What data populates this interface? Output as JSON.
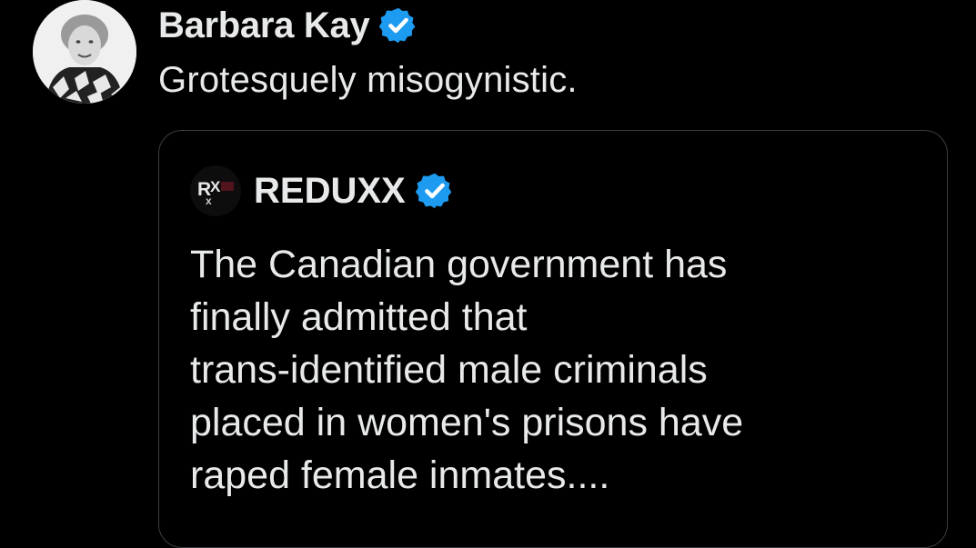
{
  "tweet": {
    "author_name": "Barbara Kay",
    "avatar": "author-avatar",
    "verified_icon": "verified-badge-icon",
    "text": "Grotesquely misogynistic."
  },
  "quote": {
    "author_name": "REDUXX",
    "logo_text": "RX",
    "verified_icon": "verified-badge-icon",
    "lines": [
      "The Canadian government has",
      "finally admitted that",
      "trans-identified male criminals",
      "placed in women's prisons have",
      "raped female inmates...."
    ]
  },
  "colors": {
    "background": "#000000",
    "text": "#e7e9ea",
    "verified": "#1d9bf0",
    "border": "#3a3d41"
  }
}
